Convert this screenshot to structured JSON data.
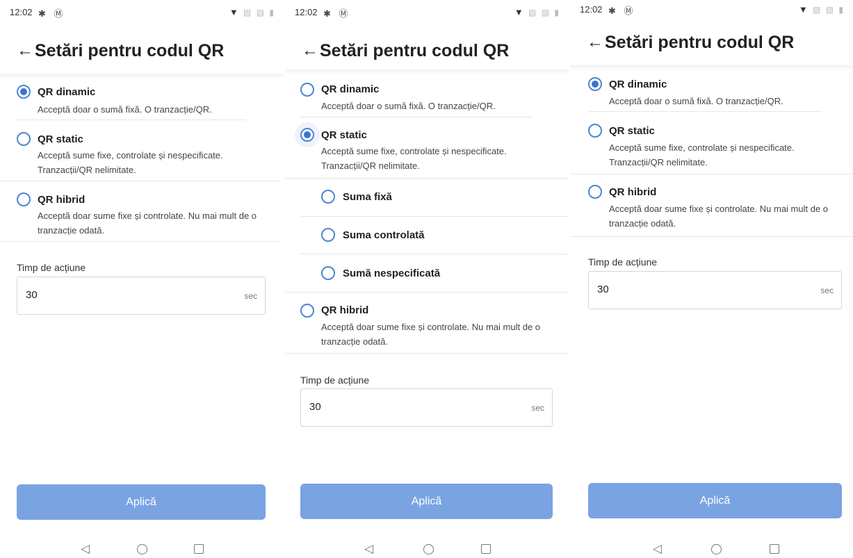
{
  "status_bar": {
    "time": "12:02",
    "app_icons": "✱ Ⓜ",
    "right_icons": "▼ ▧ ▧ ▮"
  },
  "header": {
    "back_icon": "←",
    "title": "Setări pentru codul QR"
  },
  "options": {
    "dynamic": {
      "title": "QR dinamic",
      "desc": "Acceptă doar o sumă fixă. O tranzacție/QR."
    },
    "static": {
      "title": "QR static",
      "desc": "Acceptă sume fixe, controlate și nespecificate. Tranzacții/QR nelimitate."
    },
    "hybrid": {
      "title": "QR hibrid",
      "desc": "Acceptă doar sume fixe și controlate. Nu mai mult de o tranzacție odată."
    }
  },
  "static_suboptions": [
    "Suma fixă",
    "Suma controlată",
    "Sumă nespecificată"
  ],
  "action_time": {
    "label": "Timp de acțiune",
    "value": "30",
    "unit": "sec"
  },
  "apply_label": "Aplică",
  "nav": {
    "back": "◁"
  },
  "screens": [
    {
      "selected": "QR dinamic"
    },
    {
      "selected": "QR static"
    },
    {
      "selected": "QR dinamic"
    }
  ],
  "colors": {
    "accent": "#3b74cf",
    "button": "#7aa3e2",
    "divider": "#e6e6e6"
  }
}
